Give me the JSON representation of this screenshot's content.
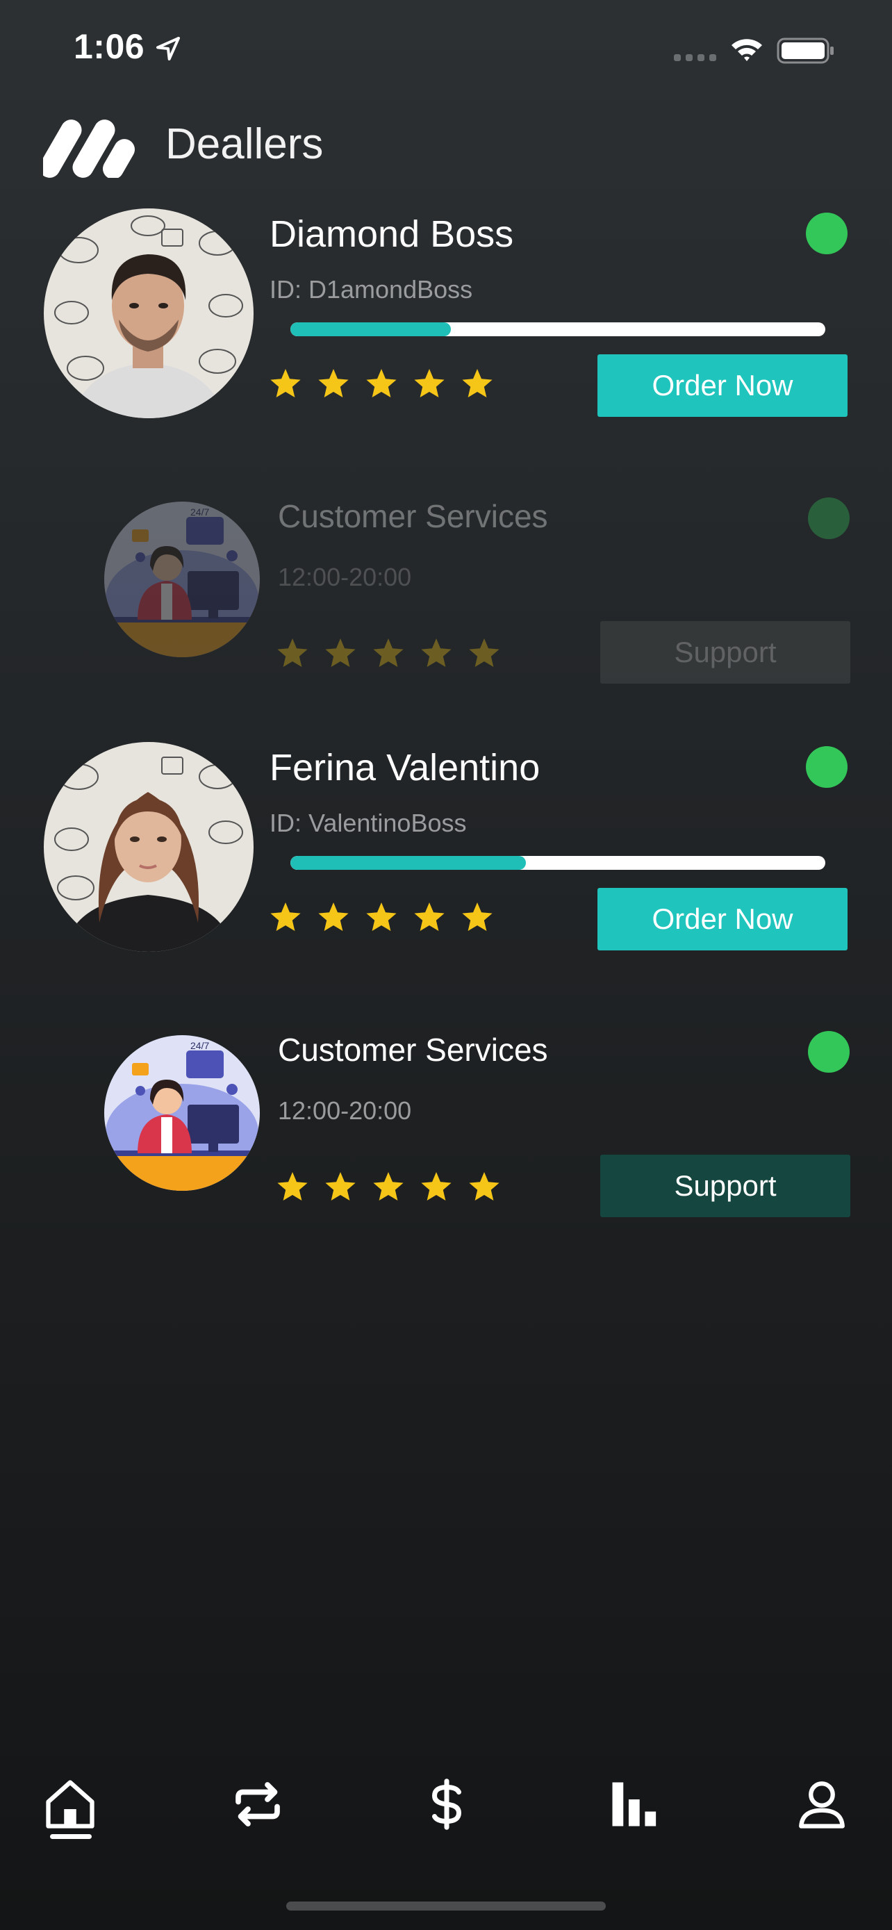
{
  "status_bar": {
    "time": "1:06",
    "icons": [
      "location-arrow-icon",
      "signal-icon",
      "wifi-icon",
      "battery-icon"
    ]
  },
  "header": {
    "logo": "app-logo-icon",
    "title": "Deallers"
  },
  "colors": {
    "accent": "#1fc4bd",
    "online": "#32c758",
    "star": "#f5c518",
    "support_button": "#164640",
    "background": "#222527"
  },
  "dealers": [
    {
      "name": "Diamond Boss",
      "id_text": "ID: D1amondBoss",
      "rating": 5,
      "progress": 0.3,
      "online": true,
      "button_label": "Order Now",
      "avatar": "man-portrait-avatar"
    },
    {
      "name": "Customer Services",
      "hours": "12:00-20:00",
      "rating": 5,
      "online": true,
      "button_label": "Support",
      "avatar": "support-agent-avatar",
      "dimmed": true
    },
    {
      "name": "Ferina Valentino",
      "id_text": "ID: ValentinoBoss",
      "rating": 5,
      "progress": 0.44,
      "online": true,
      "button_label": "Order Now",
      "avatar": "woman-portrait-avatar"
    },
    {
      "name": "Customer Services",
      "hours": "12:00-20:00",
      "rating": 5,
      "online": true,
      "button_label": "Support",
      "avatar": "support-agent-avatar"
    }
  ],
  "tab_bar": {
    "tabs": [
      {
        "icon": "home-icon",
        "selected": true
      },
      {
        "icon": "exchange-icon",
        "selected": false
      },
      {
        "icon": "dollar-icon",
        "selected": false
      },
      {
        "icon": "bar-chart-icon",
        "selected": false
      },
      {
        "icon": "profile-icon",
        "selected": false
      }
    ]
  }
}
